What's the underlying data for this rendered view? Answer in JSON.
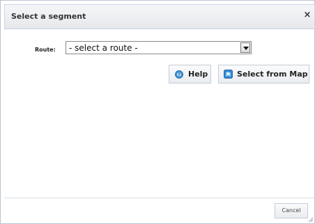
{
  "dialog": {
    "title": "Select a segment",
    "close_glyph": "×"
  },
  "form": {
    "route_label": "Route:",
    "route_selected": "- select a route -"
  },
  "actions": {
    "help_label": "Help",
    "help_icon": "help-icon",
    "select_map_label": "Select from Map",
    "select_map_icon": "map-icon"
  },
  "footer": {
    "cancel_label": "Cancel"
  },
  "colors": {
    "accent_blue": "#3a8fd6",
    "border": "#b8c4d2"
  }
}
